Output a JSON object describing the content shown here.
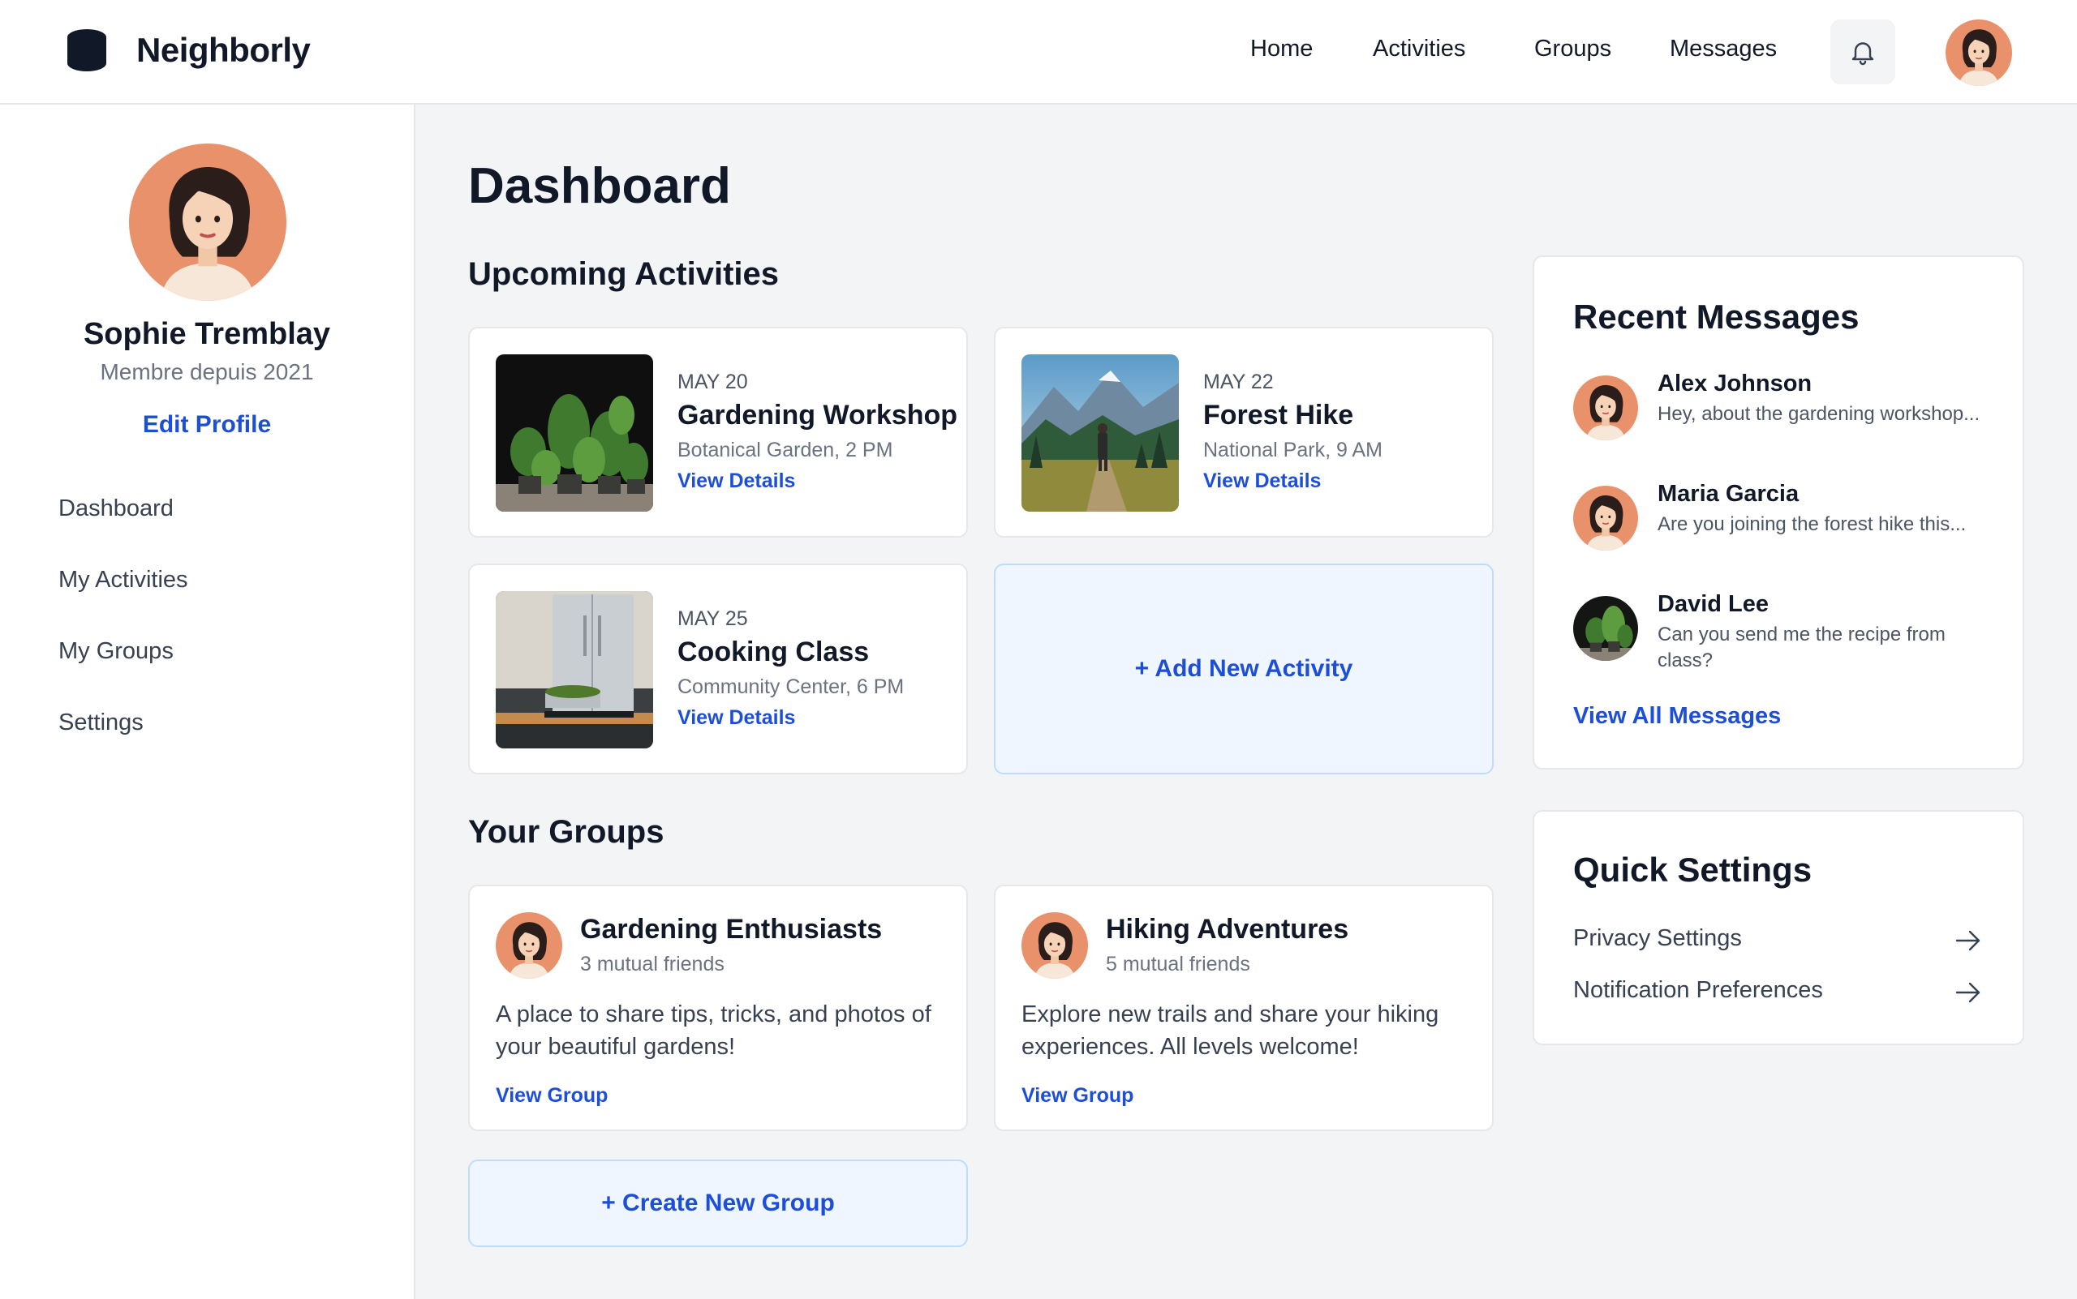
{
  "app": {
    "name": "Neighborly"
  },
  "topnav": {
    "links": [
      "Home",
      "Activities",
      "Groups",
      "Messages"
    ]
  },
  "sidebar": {
    "user_name": "Sophie Tremblay",
    "member_since": "Membre depuis 2021",
    "edit_profile": "Edit Profile",
    "items": [
      "Dashboard",
      "My Activities",
      "My Groups",
      "Settings"
    ]
  },
  "main": {
    "title": "Dashboard",
    "activities_heading": "Upcoming Activities",
    "activities": [
      {
        "date": "MAY 20",
        "title": "Gardening Workshop",
        "place": "Botanical Garden, 2 PM",
        "link": "View Details",
        "image": "plants-photo"
      },
      {
        "date": "MAY 22",
        "title": "Forest Hike",
        "place": "National Park, 9 AM",
        "link": "View Details",
        "image": "hiker-mountains-photo"
      },
      {
        "date": "MAY 25",
        "title": "Cooking Class",
        "place": "Community Center, 6 PM",
        "link": "View Details",
        "image": "kitchen-photo"
      }
    ],
    "add_activity": "+ Add New Activity",
    "groups_heading": "Your Groups",
    "groups": [
      {
        "name": "Gardening Enthusiasts",
        "friends": "3 mutual friends",
        "description": "A place to share tips, tricks, and photos of your beautiful gardens!",
        "link": "View Group"
      },
      {
        "name": "Hiking Adventures",
        "friends": "5 mutual friends",
        "description": "Explore new trails and share your hiking experiences. All levels welcome!",
        "link": "View Group"
      }
    ],
    "create_group": "+ Create New Group"
  },
  "messages": {
    "title": "Recent Messages",
    "items": [
      {
        "name": "Alex Johnson",
        "text": "Hey, about the gardening workshop..."
      },
      {
        "name": "Maria Garcia",
        "text": "Are you joining the forest hike this..."
      },
      {
        "name": "David Lee",
        "text": "Can you send me the recipe from class?"
      }
    ],
    "view_all": "View All Messages"
  },
  "quick_settings": {
    "title": "Quick Settings",
    "items": [
      "Privacy Settings",
      "Notification Preferences"
    ]
  },
  "colors": {
    "accent": "#1d4ed8",
    "avatar_bg": "#e8916a",
    "dark": "#111827"
  }
}
